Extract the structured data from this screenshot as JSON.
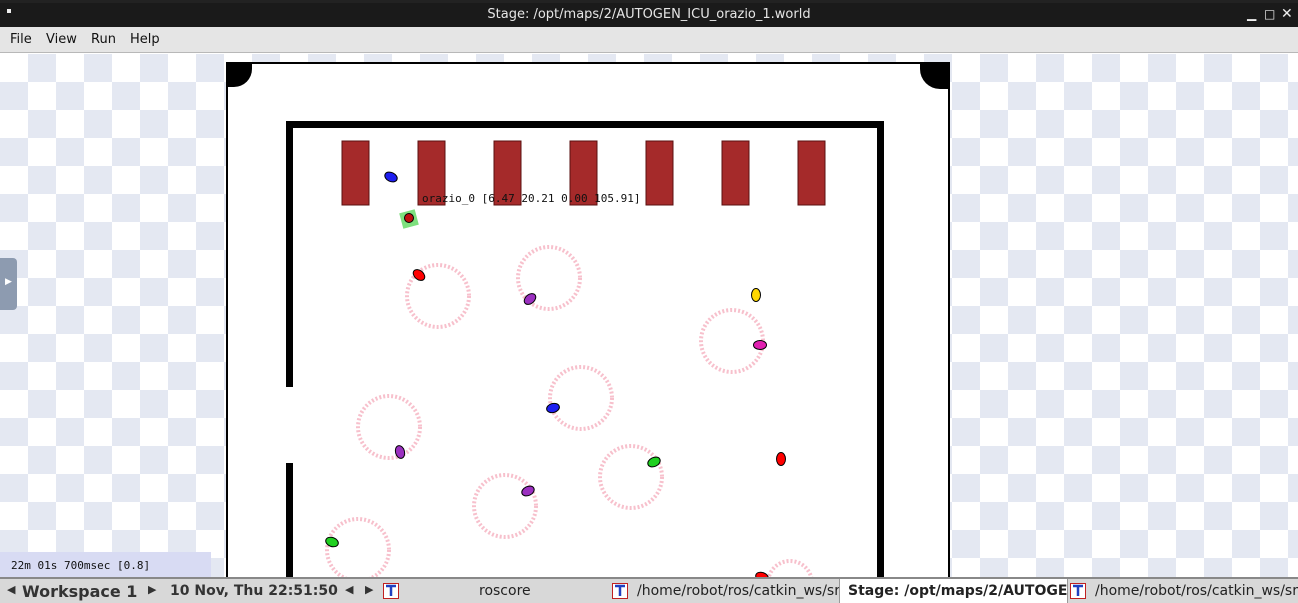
{
  "window": {
    "title": "Stage: /opt/maps/2/AUTOGEN_ICU_orazio_1.world",
    "controls": [
      "minimize-icon",
      "maximize-icon",
      "close-icon"
    ]
  },
  "menu": {
    "file": "File",
    "view": "View",
    "run": "Run",
    "help": "Help"
  },
  "canvas": {
    "robot_label": "orazio_0 [6.47 20.21 0.00 105.91]",
    "colors": {
      "wall": "#000000",
      "bed": "#a52a2a",
      "trail": "#f5b5c5"
    },
    "robots": [
      {
        "id": "r1",
        "color": "#1e1ef0"
      },
      {
        "id": "r2",
        "color": "#ff0000"
      },
      {
        "id": "r3",
        "color": "#9b30c0"
      },
      {
        "id": "r4",
        "color": "#ffd700"
      },
      {
        "id": "r5",
        "color": "#e020b0"
      },
      {
        "id": "r6",
        "color": "#1e1ef0"
      },
      {
        "id": "r7",
        "color": "#9b30c0"
      },
      {
        "id": "r8",
        "color": "#ff0000"
      },
      {
        "id": "r9",
        "color": "#20d020"
      },
      {
        "id": "r10",
        "color": "#9b30c0"
      },
      {
        "id": "r11",
        "color": "#20d020"
      },
      {
        "id": "r12",
        "color": "#ff0000"
      },
      {
        "id": "r13",
        "color": "#e020b0"
      }
    ]
  },
  "status": {
    "sim_time": "22m 01s 700msec [0.8]"
  },
  "taskbar": {
    "workspace": "Workspace 1",
    "clock": "10 Nov, Thu 22:51:50",
    "tasks": [
      {
        "label": "roscore",
        "active": false
      },
      {
        "label": "/home/robot/ros/catkin_ws/sr",
        "active": false
      },
      {
        "label": "Stage: /opt/maps/2/AUTOGE",
        "active": true
      },
      {
        "label": "/home/robot/ros/catkin_ws/sr",
        "active": false
      }
    ]
  }
}
